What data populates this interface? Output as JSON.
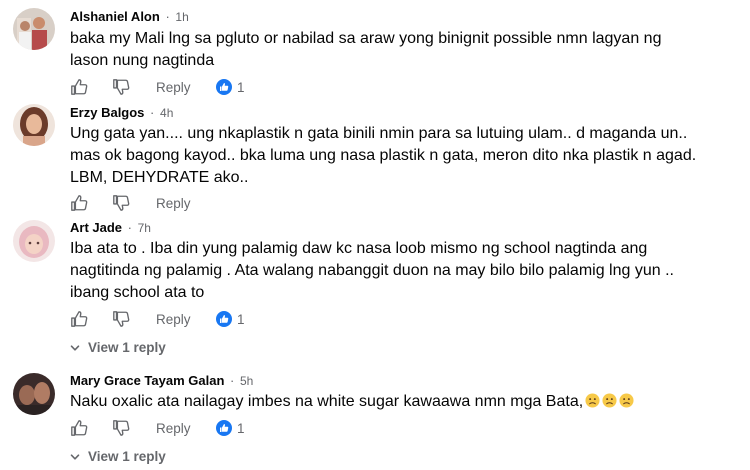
{
  "comments": [
    {
      "author": "Alshaniel Alon",
      "time": "1h",
      "lines": [
        "baka my Mali lng sa pgluto or nabilad sa araw yong binignit possible nmn lagyan ng",
        "lason nung nagtinda"
      ],
      "reply_label": "Reply",
      "reaction_count": "1"
    },
    {
      "author": "Erzy Balgos",
      "time": "4h",
      "lines": [
        "Ung gata yan.... ung nkaplastik n gata binili nmin para sa lutuing ulam.. d maganda un..",
        "mas ok bagong kayod.. bka luma ung nasa plastik n gata, meron dito nka plastik n agad.",
        "LBM, DEHYDRATE ako.."
      ],
      "reply_label": "Reply"
    },
    {
      "author": "Art Jade",
      "time": "7h",
      "lines": [
        "Iba ata to . Iba din yung palamig daw kc nasa loob mismo ng school nagtinda ang",
        "nagtitinda ng palamig . Ata walang nabanggit duon na may bilo bilo palamig lng yun ..",
        "ibang school ata to"
      ],
      "reply_label": "Reply",
      "reaction_count": "1",
      "view_replies": "View 1 reply"
    },
    {
      "author": "Mary Grace Tayam Galan",
      "time": "5h",
      "lines": [
        "Naku oxalic ata nailagay imbes na white sugar kawaawa nmn mga Bata,"
      ],
      "reply_label": "Reply",
      "reaction_count": "1",
      "view_replies": "View 1 reply"
    }
  ],
  "colors": {
    "text": "#050505",
    "secondary": "#65676b",
    "like_blue": "#1877f2"
  },
  "icons": [
    "like-icon",
    "dislike-icon",
    "like-reaction-icon",
    "chevron-down-icon",
    "sad-emoji-icon"
  ]
}
